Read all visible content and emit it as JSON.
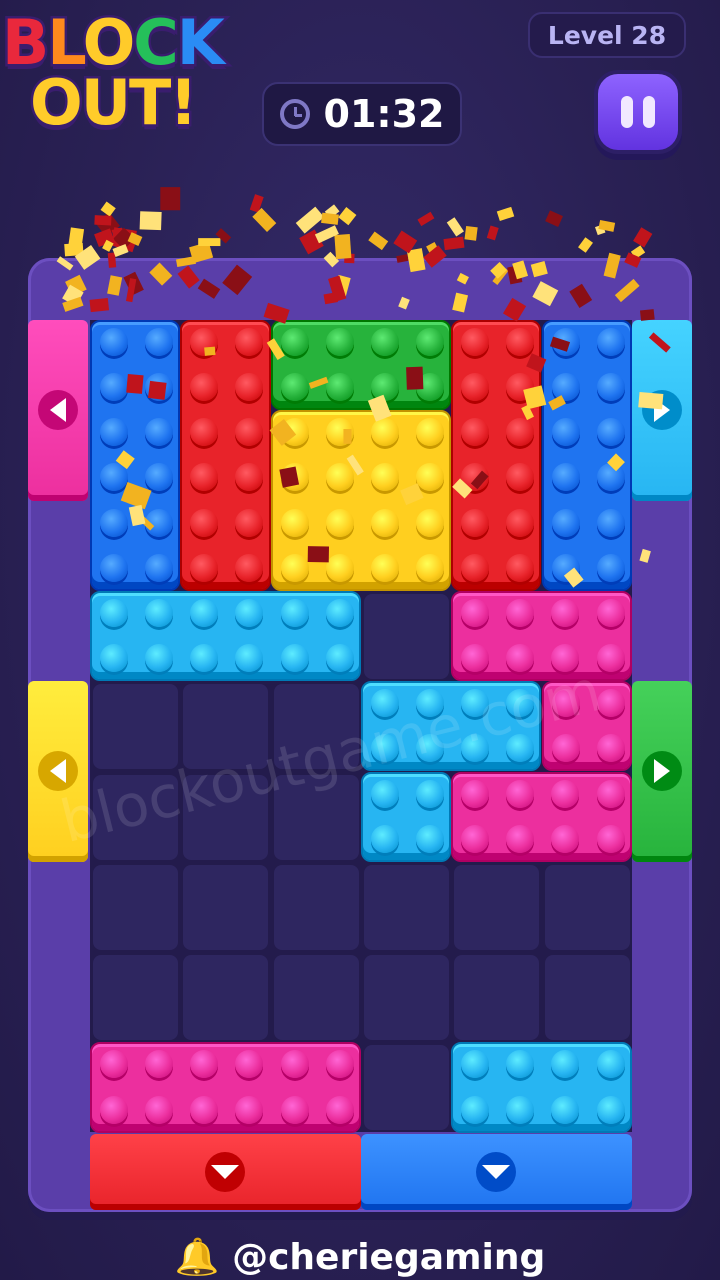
{
  "logo": {
    "line1": [
      "B",
      "L",
      "O",
      "C",
      "K"
    ],
    "line2": "OUT!"
  },
  "level_label": "Level 28",
  "timer": {
    "icon": "clock-icon",
    "value": "01:32"
  },
  "pause": {
    "icon": "pause-icon"
  },
  "watermark": "blockoutgame.com",
  "handle": "@cheriegaming",
  "handle_icon": "bell-icon",
  "colors": {
    "red": "#e8232a",
    "blue": "#1f74f0",
    "green": "#27b33c",
    "yellow": "#ffcf1f",
    "cyan": "#27b5f2",
    "pink": "#ec2f9e",
    "frame": "#5a3ea9",
    "cell": "#2e2660"
  },
  "board": {
    "cols": 6,
    "rows": 9
  },
  "blocks": [
    {
      "name": "blue-block-left",
      "color": "blue",
      "col": 0,
      "row": 0,
      "w": 1,
      "h": 3
    },
    {
      "name": "red-block-left",
      "color": "red",
      "col": 1,
      "row": 0,
      "w": 1,
      "h": 3
    },
    {
      "name": "green-block",
      "color": "green",
      "col": 2,
      "row": 0,
      "w": 2,
      "h": 1
    },
    {
      "name": "yellow-block",
      "color": "yellow",
      "col": 2,
      "row": 1,
      "w": 2,
      "h": 2
    },
    {
      "name": "red-block-right",
      "color": "red",
      "col": 4,
      "row": 0,
      "w": 1,
      "h": 3
    },
    {
      "name": "blue-block-right",
      "color": "blue",
      "col": 5,
      "row": 0,
      "w": 1,
      "h": 3
    },
    {
      "name": "cyan-bar-block",
      "color": "cyan",
      "col": 0,
      "row": 3,
      "w": 3,
      "h": 1
    },
    {
      "name": "pink-bar-block",
      "color": "pink",
      "col": 4,
      "row": 3,
      "w": 2,
      "h": 1
    },
    {
      "name": "cyan-l-block-top",
      "color": "cyan",
      "col": 3,
      "row": 4,
      "w": 2,
      "h": 1
    },
    {
      "name": "cyan-l-block-bottom",
      "color": "cyan",
      "col": 3,
      "row": 5,
      "w": 1,
      "h": 1
    },
    {
      "name": "pink-l-block-top",
      "color": "pink",
      "col": 5,
      "row": 4,
      "w": 1,
      "h": 1
    },
    {
      "name": "pink-l-block-bottom",
      "color": "pink",
      "col": 4,
      "row": 5,
      "w": 2,
      "h": 1
    },
    {
      "name": "pink-bottom-block",
      "color": "pink",
      "col": 0,
      "row": 8,
      "w": 3,
      "h": 1
    },
    {
      "name": "cyan-bottom-block",
      "color": "cyan",
      "col": 4,
      "row": 8,
      "w": 2,
      "h": 1
    }
  ],
  "gates": [
    {
      "name": "pink-left-gate",
      "color": "pink",
      "side": "left",
      "start": 0,
      "len": 2,
      "arrow": "left"
    },
    {
      "name": "yellow-left-gate",
      "color": "yellow",
      "side": "left",
      "start": 4,
      "len": 2,
      "arrow": "left"
    },
    {
      "name": "cyan-right-gate",
      "color": "cyan",
      "side": "right",
      "start": 0,
      "len": 2,
      "arrow": "right"
    },
    {
      "name": "green-right-gate",
      "color": "green",
      "side": "right",
      "start": 4,
      "len": 2,
      "arrow": "right"
    },
    {
      "name": "red-bottom-gate",
      "color": "red",
      "side": "bottom",
      "start": 0,
      "len": 3,
      "arrow": "down"
    },
    {
      "name": "blue-bottom-gate",
      "color": "blue",
      "side": "bottom",
      "start": 3,
      "len": 3,
      "arrow": "down"
    }
  ]
}
